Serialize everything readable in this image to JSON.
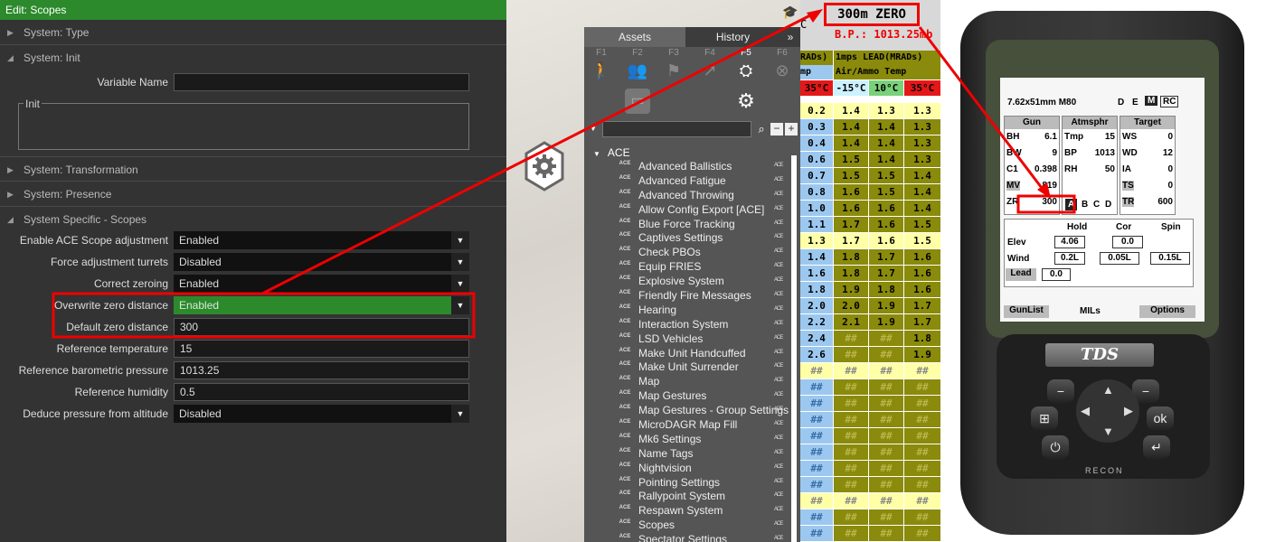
{
  "edit_panel": {
    "title": "Edit: Scopes",
    "sections": {
      "type": "System: Type",
      "init": "System: Init",
      "transformation": "System: Transformation",
      "presence": "System: Presence",
      "specific": "System Specific - Scopes"
    },
    "init": {
      "variable_name_label": "Variable Name",
      "variable_name_value": "",
      "init_label": "Init",
      "init_value": ""
    },
    "attributes": [
      {
        "label": "Enable ACE Scope adjustment",
        "value": "Enabled"
      },
      {
        "label": "Force adjustment turrets",
        "value": "Disabled"
      },
      {
        "label": "Correct zeroing",
        "value": "Enabled"
      },
      {
        "label": "Overwrite zero distance",
        "value": "Enabled"
      },
      {
        "label": "Default zero distance",
        "value": "300"
      },
      {
        "label": "Reference temperature",
        "value": "15"
      },
      {
        "label": "Reference barometric pressure",
        "value": "1013.25"
      },
      {
        "label": "Reference humidity",
        "value": "0.5"
      },
      {
        "label": "Deduce pressure from altitude",
        "value": "Disabled"
      }
    ]
  },
  "asset_browser": {
    "tabs": [
      "Assets",
      "History",
      "»"
    ],
    "fkeys": [
      "F1",
      "F2",
      "F3",
      "F4",
      "F5",
      "F6"
    ],
    "tree_root": "ACE",
    "modules": [
      "Advanced Ballistics",
      "Advanced Fatigue",
      "Advanced Throwing",
      "Allow Config Export [ACE]",
      "Blue Force Tracking",
      "Captives Settings",
      "Check PBOs",
      "Equip FRIES",
      "Explosive System",
      "Friendly Fire Messages",
      "Hearing",
      "Interaction System",
      "LSD Vehicles",
      "Make Unit Handcuffed",
      "Make Unit Surrender",
      "Map",
      "Map Gestures",
      "Map Gestures - Group Settings",
      "MicroDAGR Map Fill",
      "Mk6 Settings",
      "Name Tags",
      "Nightvision",
      "Pointing Settings",
      "Rallypoint System",
      "Respawn System",
      "Scopes",
      "Spectator Settings"
    ],
    "module_icon_text": "ACE",
    "module_tag_text": "ACE"
  },
  "range_card": {
    "zero": "300m  ZERO",
    "pressure": "B.P.:  1013.25mb",
    "c_fragment": "C",
    "headers": {
      "h1a": "RADs)",
      "h1b": "1mps LEAD(MRADs)",
      "h2a": "mp",
      "h2b": "Air/Ammo Temp"
    },
    "temps": [
      "35°C",
      "-15°C",
      "10°C",
      "35°C"
    ],
    "rows": [
      [
        "0.2",
        "1.4",
        "1.3",
        "1.3"
      ],
      [
        "0.3",
        "1.4",
        "1.4",
        "1.3"
      ],
      [
        "0.4",
        "1.4",
        "1.4",
        "1.3"
      ],
      [
        "0.6",
        "1.5",
        "1.4",
        "1.3"
      ],
      [
        "0.7",
        "1.5",
        "1.5",
        "1.4"
      ],
      [
        "0.8",
        "1.6",
        "1.5",
        "1.4"
      ],
      [
        "1.0",
        "1.6",
        "1.6",
        "1.4"
      ],
      [
        "1.1",
        "1.7",
        "1.6",
        "1.5"
      ],
      [
        "1.3",
        "1.7",
        "1.6",
        "1.5"
      ],
      [
        "1.4",
        "1.8",
        "1.7",
        "1.6"
      ],
      [
        "1.6",
        "1.8",
        "1.7",
        "1.6"
      ],
      [
        "1.8",
        "1.9",
        "1.8",
        "1.6"
      ],
      [
        "2.0",
        "2.0",
        "1.9",
        "1.7"
      ],
      [
        "2.2",
        "2.1",
        "1.9",
        "1.7"
      ],
      [
        "2.4",
        "##",
        "##",
        "1.8"
      ],
      [
        "2.6",
        "##",
        "##",
        "1.9"
      ],
      [
        "##",
        "##",
        "##",
        "##"
      ],
      [
        "##",
        "##",
        "##",
        "##"
      ],
      [
        "##",
        "##",
        "##",
        "##"
      ],
      [
        "##",
        "##",
        "##",
        "##"
      ],
      [
        "##",
        "##",
        "##",
        "##"
      ],
      [
        "##",
        "##",
        "##",
        "##"
      ],
      [
        "##",
        "##",
        "##",
        "##"
      ],
      [
        "##",
        "##",
        "##",
        "##"
      ],
      [
        "##",
        "##",
        "##",
        "##"
      ],
      [
        "##",
        "##",
        "##",
        "##"
      ],
      [
        "##",
        "##",
        "##",
        "##"
      ]
    ],
    "highlight_rows": [
      0,
      8,
      16,
      24
    ],
    "colors": {
      "olive": "#8a8a0c",
      "blue": "#9cc8f0",
      "yellow": "#ffffa8",
      "red": "#e41818",
      "green": "#7ad17a",
      "cyan": "#ccf2ff"
    }
  },
  "device": {
    "caliber": "7.62x51mm  M80",
    "modes": [
      "D",
      "E",
      "M",
      "RC"
    ],
    "active_mode": "M",
    "gun": {
      "title": "Gun",
      "rows": [
        [
          "BH",
          "6.1"
        ],
        [
          "BW",
          "9"
        ],
        [
          "C1",
          "0.398"
        ],
        [
          "MV",
          "819"
        ],
        [
          "ZR",
          "300"
        ]
      ]
    },
    "atmos": {
      "title": "Atmsphr",
      "rows": [
        [
          "Tmp",
          "15"
        ],
        [
          "BP",
          "1013"
        ],
        [
          "RH",
          "50"
        ]
      ],
      "profiles": [
        "A",
        "B",
        "C",
        "D"
      ]
    },
    "target": {
      "title": "Target",
      "rows": [
        [
          "WS",
          "0"
        ],
        [
          "WD",
          "12"
        ],
        [
          "IA",
          "0"
        ],
        [
          "TS",
          "0"
        ],
        [
          "TR",
          "600"
        ]
      ]
    },
    "solution": {
      "headers": [
        "Hold",
        "Cor",
        "Spin"
      ],
      "elev_label": "Elev",
      "elev": "4.06",
      "elev_cor": "0.0",
      "wind_label": "Wind",
      "wind": "0.2L",
      "wind_cor": "0.05L",
      "spin": "0.15L",
      "lead_label": "Lead",
      "lead": "0.0"
    },
    "softkeys": [
      "GunList",
      "MILs",
      "Options"
    ],
    "brand": "TDS",
    "model": "RECON",
    "ok_label": "ok"
  }
}
